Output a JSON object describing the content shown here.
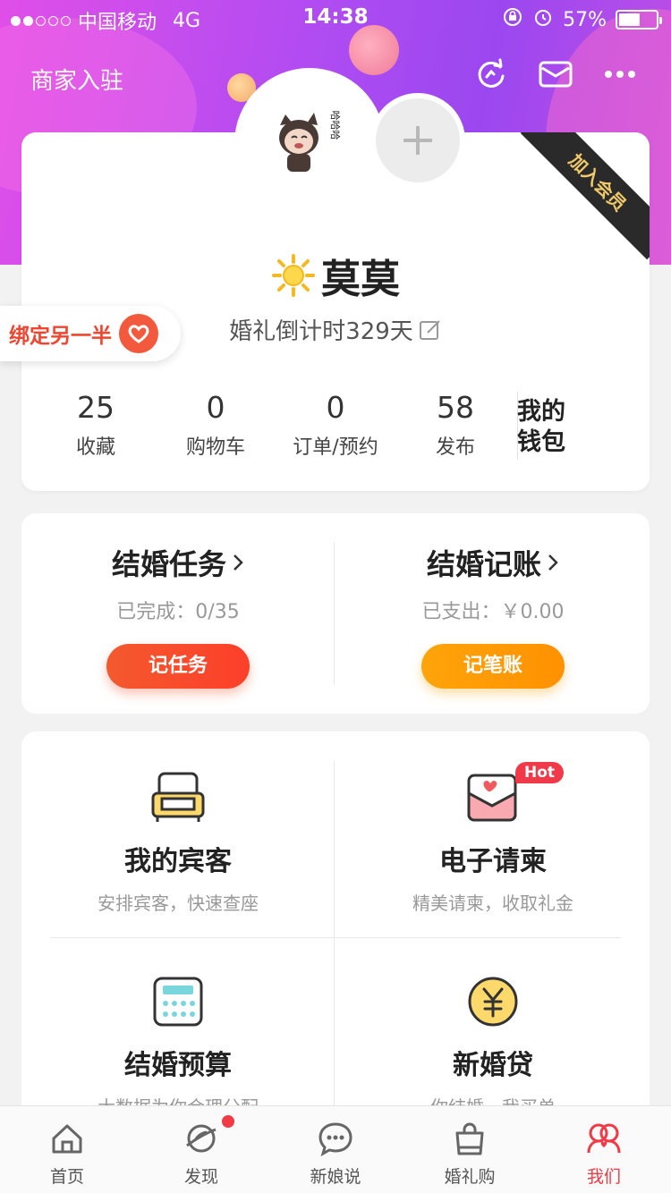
{
  "status_bar": {
    "carrier": "中国移动",
    "network": "4G",
    "time": "14:38",
    "battery": "57%",
    "battery_level": 0.57
  },
  "header": {
    "merchant_link": "商家入驻",
    "icons": [
      "refresh-icon",
      "mail-icon",
      "more-icon"
    ]
  },
  "profile": {
    "member_ribbon": "加入会员",
    "avatar_caption": "哈哈哈",
    "username": "莫莫",
    "countdown": "婚礼倒计时329天",
    "bind_partner": "绑定另一半",
    "stats": [
      {
        "value": "25",
        "label": "收藏"
      },
      {
        "value": "0",
        "label": "购物车"
      },
      {
        "value": "0",
        "label": "订单/预约"
      },
      {
        "value": "58",
        "label": "发布"
      }
    ],
    "wallet": "我的钱包"
  },
  "tasks": {
    "left": {
      "title": "结婚任务",
      "subtitle": "已完成：0/35",
      "button": "记任务"
    },
    "right": {
      "title": "结婚记账",
      "subtitle": "已支出：￥0.00",
      "button": "记笔账"
    }
  },
  "features": [
    {
      "title": "我的宾客",
      "subtitle": "安排宾客，快速查座",
      "icon": "sofa-icon"
    },
    {
      "title": "电子请柬",
      "subtitle": "精美请柬，收取礼金",
      "icon": "invitation-icon",
      "badge": "Hot"
    },
    {
      "title": "结婚预算",
      "subtitle": "大数据为你合理分配",
      "icon": "calculator-icon"
    },
    {
      "title": "新婚贷",
      "subtitle": "你结婚，我买单",
      "icon": "yen-coin-icon"
    }
  ],
  "tabbar": [
    {
      "label": "首页",
      "icon": "home-icon"
    },
    {
      "label": "发现",
      "icon": "planet-icon",
      "dot": true
    },
    {
      "label": "新娘说",
      "icon": "chat-icon"
    },
    {
      "label": "婚礼购",
      "icon": "bag-icon"
    },
    {
      "label": "我们",
      "icon": "couple-icon",
      "active": true
    }
  ],
  "colors": {
    "accent_red": "#f03a45",
    "header_gradient_start": "#e04ee8",
    "header_gradient_end": "#9b47f0",
    "orange": "#ffa40a"
  }
}
